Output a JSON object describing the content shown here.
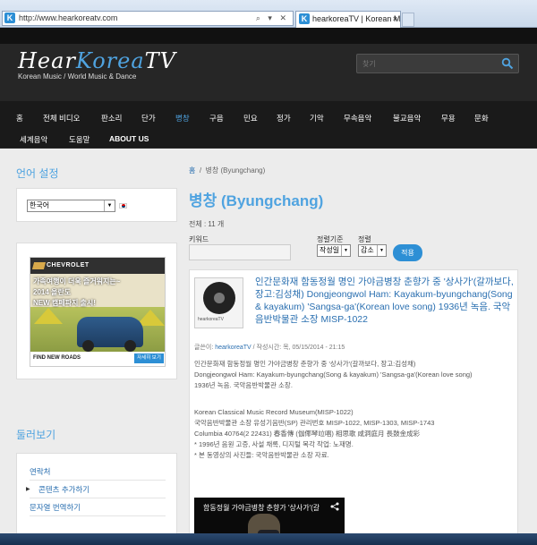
{
  "browser": {
    "url": "http://www.hearkoreatv.com",
    "tab_title": "hearkoreaTV | Korean Musi...",
    "favicon_letter": "K",
    "tab_close": "×"
  },
  "header": {
    "logo_hear": "Hear",
    "logo_korea": "Korea",
    "logo_tv": "TV",
    "tagline": "Korean Music / World Music & Dance",
    "search_placeholder": "찾기"
  },
  "nav": {
    "row1": [
      "홈",
      "전체 비디오",
      "판소리",
      "단가",
      "병창",
      "구음",
      "민요",
      "정가",
      "기악",
      "무속음악",
      "불교음악",
      "무용",
      "문화"
    ],
    "row2": [
      "세계음악",
      "도움말",
      "ABOUT US"
    ],
    "active": "병창"
  },
  "sidebar": {
    "lang_title": "언어 설정",
    "lang_value": "한국어",
    "browse_title": "둘러보기",
    "links": [
      "연락처",
      "콘텐츠 추가하기",
      "문자열 번역하기"
    ]
  },
  "ad": {
    "brand": "CHEVROLET",
    "line1": "가족여행이 더욱 즐거워지는~",
    "line2": "2014 올란도",
    "line3": "NEW 캠페파지 출시!",
    "find": "FIND NEW ROADS",
    "button": "자세히 보기"
  },
  "main": {
    "breadcrumb_home": "홈",
    "breadcrumb_sep": "/",
    "breadcrumb_current": "병창 (Byungchang)",
    "title": "병창 (Byungchang)",
    "total": "전체 : 11 개",
    "keyword_label": "키워드",
    "sort_label": "정렬기준",
    "sort_value": "작성일",
    "order_label": "정렬",
    "order_value": "감소",
    "apply": "적용"
  },
  "article": {
    "thumb_text": "hearkoreaTV",
    "title": "인간문화재 함동정월 명인 가야금병창 춘향가 중 '상사가'(갈까보다, 장고:김성채) Dongjeongwol Ham: Kayakum-byungchang(Song & kayakum) 'Sangsa-ga'(Korean love song) 1936년 녹음. 국악음반박물관 소장 MISP-1022",
    "meta_prefix": "글쓴이: ",
    "meta_author": "hearkoreaTV",
    "meta_suffix": " / 작성시간: 목, 05/15/2014 - 21:15",
    "body": [
      "인간문화재 함동정월 명인 가야금병창 춘향가 중 '상사가'(갈까보다, 장고:김성채)",
      "Dongjeongwol Ham: Kayakum-byungchang(Song & kayakum) 'Sangsa-ga'(Korean love song)",
      "1936년 녹음. 국악음반박물관 소장.",
      "",
      "Korean Classical Music Record Museum(MISP-1022)",
      "국악음반박물관 소장 유성기음반(SP) 관리번호 MISP-1022, MISP-1303, MISP-1743",
      "Columbia 40764(2 22431) 春香傳 (伽倻琴竝唱) 相思歌 咸洞庭月 長鼓金成彩",
      "* 1996년 음원 고증, 사설 채록, 디지털 복각 작업: 노재명.",
      "* 본 동영상의 사진들: 국악음반박물관 소장 자료."
    ],
    "video_title": "함동정월 가야금병창 춘향가 '상사가'(갈"
  }
}
